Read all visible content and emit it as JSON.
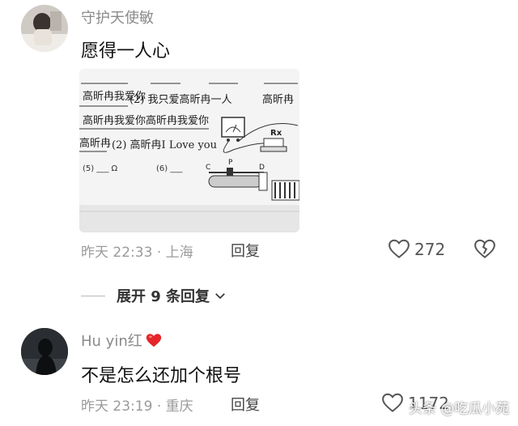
{
  "comments": [
    {
      "username": "守护天使敏",
      "text": "愿得一人心",
      "attachment": {
        "lines": [
          "高昕冉我爱你",
          "(2) 我只爱高昕冉一人",
          "高昕冉",
          "高昕冉我爱你高昕冉我爱你",
          "高昕冉",
          "(2) 高昕冉I Love you",
          "(5) ___ Ω",
          "(6) ___",
          "Rx",
          "C",
          "P",
          "D"
        ]
      },
      "time": "昨天 22:33",
      "separator": "·",
      "location": "上海",
      "reply_label": "回复",
      "like_count": "272"
    },
    {
      "username": "Hu yin红",
      "text": "不是怎么还加个根号",
      "time": "昨天 23:19",
      "separator": "·",
      "location": "重庆",
      "reply_label": "回复",
      "like_count": "1172"
    }
  ],
  "expand_label": "展开 9 条回复",
  "watermark": "头条 @吃瓜小苑",
  "icons": [
    "heart-outline-icon",
    "broken-heart-icon",
    "chevron-down-icon",
    "red-heart-emoji"
  ]
}
